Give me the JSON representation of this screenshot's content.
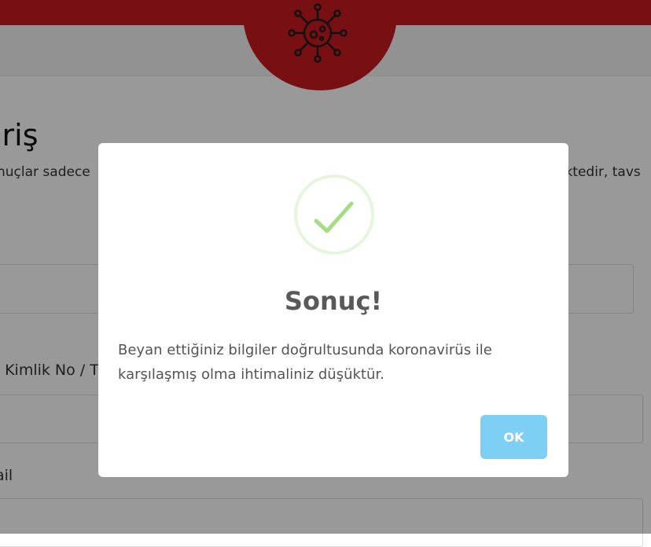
{
  "page": {
    "heading": "iriş",
    "description_left": "nuçlar sadece",
    "description_right": "ektedir, tavs",
    "fields": [
      {
        "label": ". Kimlik No / T"
      },
      {
        "label": "ail"
      }
    ]
  },
  "modal": {
    "title": "Sonuç!",
    "text": "Beyan ettiğiniz bilgiler doğrultusunda koronavirüs ile karşılaşmış olma ihtimaliniz düşüktür.",
    "ok_label": "OK",
    "icon": "success-check-icon"
  },
  "colors": {
    "brand": "#c8191f",
    "ok_button": "#7ecff4",
    "success": "#a5dc86"
  }
}
